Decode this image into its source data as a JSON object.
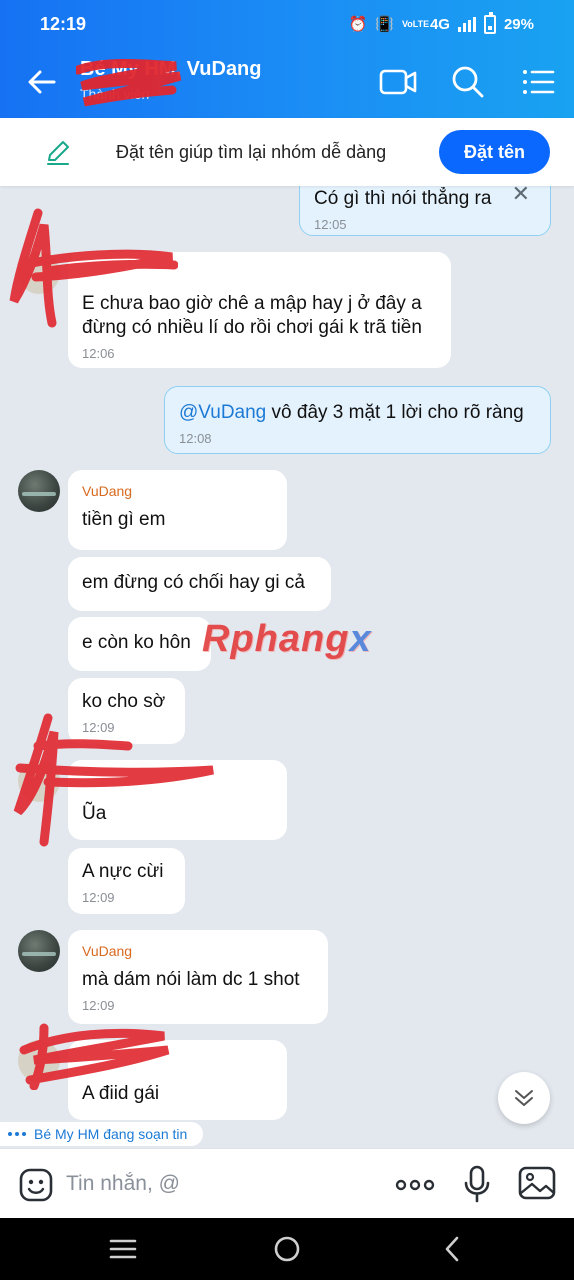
{
  "status_bar": {
    "time": "12:19",
    "network": "4G",
    "volte": "VoLTE",
    "battery": "29%"
  },
  "header": {
    "title": "Bé My HM, VuDang",
    "subtitle": "Thành viên"
  },
  "banner": {
    "text": "Đặt tên giúp tìm lại nhóm dễ dàng",
    "button_label": "Đặt tên"
  },
  "messages": [
    {
      "direction": "out",
      "text": "Có gì thì nói thẳng ra",
      "time": "12:05"
    },
    {
      "direction": "in",
      "text": "E chưa bao giờ chê a mập hay j ở đây a đừng có nhiều lí do rồi chơi gái k trã tiền",
      "time": "12:06"
    },
    {
      "direction": "out",
      "mention": "@VuDang",
      "text": " vô đây 3 mặt 1 lời cho rõ ràng",
      "time": "12:08"
    },
    {
      "direction": "in",
      "sender": "VuDang",
      "text": "tiền gì em"
    },
    {
      "direction": "in",
      "text": "em đừng có chối hay gi cả"
    },
    {
      "direction": "in",
      "text": "e còn ko hôn"
    },
    {
      "direction": "in",
      "text": "ko cho sờ",
      "time": "12:09"
    },
    {
      "direction": "in",
      "text": "Ũa"
    },
    {
      "direction": "in",
      "text": "A nực cừi",
      "time": "12:09"
    },
    {
      "direction": "in",
      "sender": "VuDang",
      "text": "mà dám nói làm dc 1 shot",
      "time": "12:09"
    },
    {
      "direction": "in",
      "text": "A điid gái"
    }
  ],
  "watermark": {
    "part1": "Rphang",
    "part2": "x"
  },
  "typing_indicator": "Bé My HM đang soạn tin",
  "composer": {
    "placeholder": "Tin nhắn, @",
    "value": ""
  },
  "icons": {
    "back": "arrow-left-icon",
    "video": "video-call-icon",
    "search": "search-icon",
    "menu": "list-menu-icon",
    "edit": "pencil-icon",
    "emoji": "emoji-icon",
    "more": "more-dots-icon",
    "mic": "microphone-icon",
    "image": "image-icon",
    "scroll": "chevron-down-double-icon"
  },
  "colors": {
    "header_start": "#1672f3",
    "header_end": "#19a2f1",
    "accent": "#0a68ff",
    "outgoing_bubble": "#e4f2fd",
    "sender_name": "#d9691f",
    "chat_bg": "#e3e8ef"
  }
}
